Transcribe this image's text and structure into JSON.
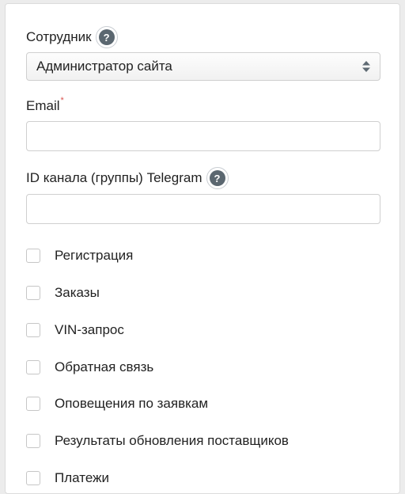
{
  "form": {
    "employee_label": "Сотрудник",
    "employee_value": "Администратор сайта",
    "email_label": "Email",
    "email_required_mark": "*",
    "email_value": "",
    "telegram_label": "ID канала (группы) Telegram",
    "telegram_value": "",
    "help_glyph": "?"
  },
  "notifications": [
    {
      "label": "Регистрация",
      "checked": false
    },
    {
      "label": "Заказы",
      "checked": false
    },
    {
      "label": "VIN-запрос",
      "checked": false
    },
    {
      "label": "Обратная связь",
      "checked": false
    },
    {
      "label": "Оповещения по заявкам",
      "checked": false
    },
    {
      "label": "Результаты обновления поставщиков",
      "checked": false
    },
    {
      "label": "Платежи",
      "checked": false
    }
  ],
  "icons": {
    "help": "question-circle-icon",
    "select_arrows": "sort-arrows-icon"
  },
  "colors": {
    "required": "#d9534f",
    "help_bg": "#5b6770",
    "select_arrows": "#5f6b74"
  }
}
